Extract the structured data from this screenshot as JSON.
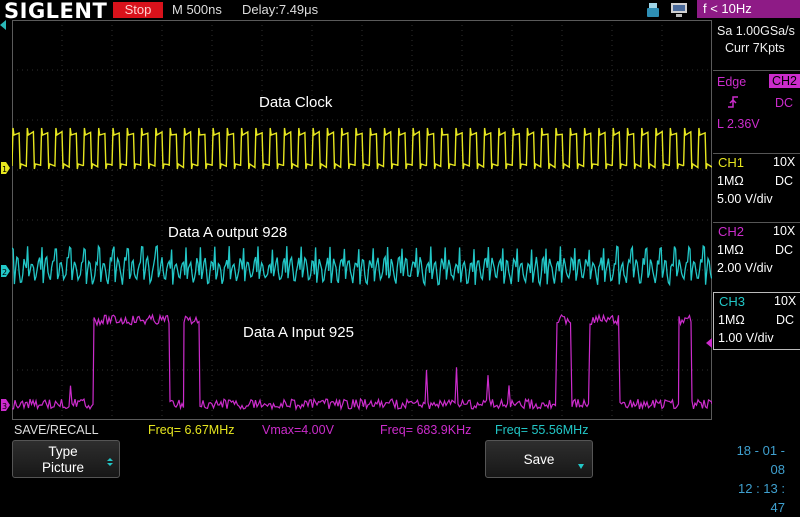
{
  "topbar": {
    "brand": "SIGLENT",
    "run_status": "Stop",
    "timebase": "M 500ns",
    "delay": "Delay:7.49μs",
    "trigger_freq": "f < 10Hz",
    "icons": [
      "usb-icon",
      "monitor-icon"
    ]
  },
  "acquisition": {
    "sample_rate": "Sa 1.00GSa/s",
    "memory_depth": "Curr 7Kpts"
  },
  "trigger": {
    "type": "Edge",
    "source": "CH2",
    "slope_icon": "rising-edge-icon",
    "coupling": "DC",
    "level": "L  2.36V"
  },
  "channels": [
    {
      "name": "CH1",
      "probe": "10X",
      "impedance": "1MΩ",
      "coupling": "DC",
      "scale": "5.00 V/div",
      "color": "#e6e61f"
    },
    {
      "name": "CH2",
      "probe": "10X",
      "impedance": "1MΩ",
      "coupling": "DC",
      "scale": "2.00 V/div",
      "color": "#22c7c7"
    },
    {
      "name": "CH3",
      "probe": "10X",
      "impedance": "1MΩ",
      "coupling": "DC",
      "scale": "1.00 V/div",
      "color": "#cc2ccc"
    }
  ],
  "trace_labels": {
    "ch1": "Data Clock",
    "ch2": "Data A output 928",
    "ch3": "Data A Input 925"
  },
  "measurements": {
    "menu_title": "SAVE/RECALL",
    "ch1_freq": "Freq= 6.67MHz",
    "ch1_vmax": "Vmax=4.00V",
    "ch3_freq": "Freq= 683.9KHz",
    "ch2_freq": "Freq= 55.56MHz"
  },
  "softkeys": {
    "type_label": "Type",
    "type_value": "Picture",
    "save_label": "Save"
  },
  "datetime": {
    "date": "18 - 01 - 08",
    "time": "12 : 13 : 47"
  }
}
